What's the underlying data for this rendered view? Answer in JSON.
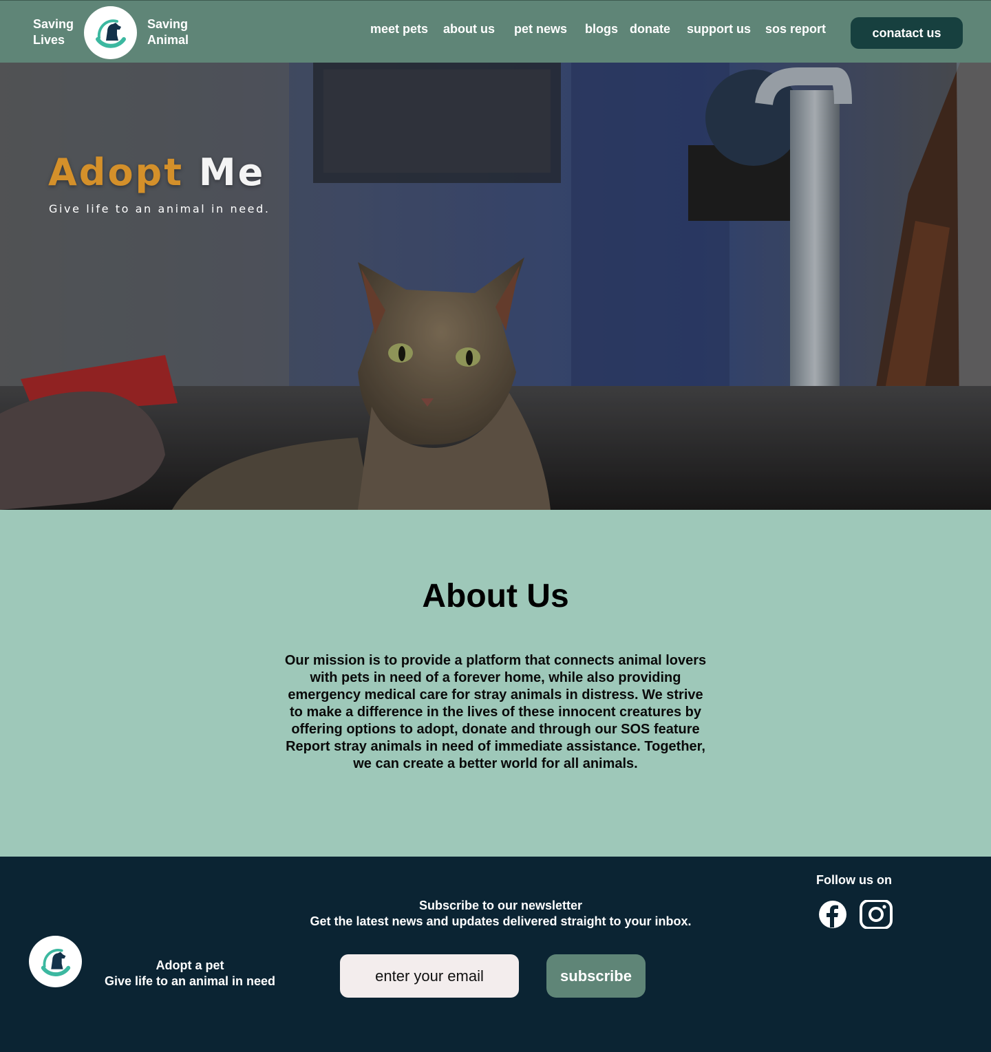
{
  "colors": {
    "header_bg": "#5f8577",
    "accent_dark": "#17403f",
    "about_bg": "#9ec8b9",
    "footer_bg": "#0b2433",
    "adopt_orange": "#d4902a"
  },
  "header": {
    "brand_left_line1": "Saving",
    "brand_left_line2": "Lives",
    "brand_right_line1": "Saving",
    "brand_right_line2": "Animal",
    "logo_icon": "dog-in-hand-logo-icon",
    "nav": [
      "meet pets",
      "about us",
      "pet news",
      "blogs",
      "donate",
      "support us",
      "sos report"
    ],
    "contact_label": "conatact us"
  },
  "hero": {
    "title_word1": "Adopt",
    "title_word2": "Me",
    "subtitle": "Give life to an animal in need.",
    "image": "stray-cat-photo"
  },
  "about": {
    "heading": "About Us",
    "body": "Our mission is to provide a platform that connects animal lovers with pets in need of a forever home, while also providing emergency medical care for stray animals in distress. We strive to make a difference in the lives of these innocent creatures by offering options to adopt, donate and through our SOS feature Report stray animals in need of immediate assistance. Together, we can create a better world for all animals."
  },
  "footer": {
    "follow": "Follow us on",
    "social": [
      "facebook-icon",
      "instagram-icon"
    ],
    "newsletter_title": "Subscribe to our newsletter",
    "newsletter_sub": "Get the latest news and updates delivered straight to your inbox.",
    "adopt_title": "Adopt a pet",
    "adopt_sub": "Give life to an animal in need",
    "email_placeholder": "enter your email",
    "subscribe_label": "subscribe"
  }
}
